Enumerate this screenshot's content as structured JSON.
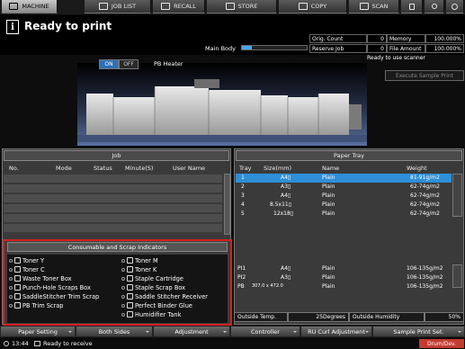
{
  "tabs": [
    {
      "label": "MACHINE",
      "active": true
    },
    {
      "label": "JOB LIST",
      "active": false
    },
    {
      "label": "RECALL",
      "active": false
    },
    {
      "label": "STORE",
      "active": false
    },
    {
      "label": "COPY",
      "active": false
    },
    {
      "label": "SCAN",
      "active": false
    }
  ],
  "header": {
    "title": "Ready to print",
    "main_body_label": "Main Body",
    "main_body_level": 0.15
  },
  "counters": {
    "orig_count_label": "Orig. Count",
    "orig_count": "0",
    "memory_label": "Memory",
    "memory": "100.000%",
    "reserve_job_label": "Reserve Job",
    "reserve_job": "0",
    "file_amount_label": "File Amount",
    "file_amount": "100.000%"
  },
  "scanner_status": "Ready to use scanner",
  "exec_sample_print": "Execute Sample Print",
  "pb_heater": {
    "on": "ON",
    "off": "OFF",
    "label": "PB Heater",
    "state": "on"
  },
  "job": {
    "title": "Job",
    "columns": [
      "No.",
      "Mode",
      "Status",
      "Minute(S)",
      "User Name"
    ]
  },
  "consumables": {
    "title": "Consumable and Scrap Indicators",
    "left": [
      "Toner Y",
      "Toner C",
      "Waste Toner Box",
      "Punch-Hole Scraps Box",
      "SaddleStitcher Trim Scrap",
      "PB Trim Scrap"
    ],
    "right": [
      "Toner M",
      "Toner K",
      "Staple Cartridge",
      "Staple Scrap Box",
      "Saddle Stitcher Receiver",
      "Perfect Binder Glue",
      "Humidifier Tank"
    ]
  },
  "tray": {
    "title": "Paper Tray",
    "columns": [
      "Tray",
      "Size(mm)",
      "Name",
      "Weight"
    ],
    "rows": [
      {
        "tray": "1",
        "size": "A4▯",
        "name": "Plain",
        "weight": "81-91g/m2",
        "selected": true
      },
      {
        "tray": "2",
        "size": "A3▯",
        "name": "Plain",
        "weight": "62-74g/m2",
        "selected": false
      },
      {
        "tray": "3",
        "size": "A4▯",
        "name": "Plain",
        "weight": "62-74g/m2",
        "selected": false
      },
      {
        "tray": "4",
        "size": "8.5x11▯",
        "name": "Plain",
        "weight": "62-74g/m2",
        "selected": false
      },
      {
        "tray": "5",
        "size": "12x18▯",
        "name": "Plain",
        "weight": "62-74g/m2",
        "selected": false
      }
    ],
    "lower_rows": [
      {
        "tray": "PI1",
        "size": "A4▯",
        "name": "Plain",
        "weight": "106-135g/m2"
      },
      {
        "tray": "PI2",
        "size": "A3▯",
        "name": "Plain",
        "weight": "106-135g/m2"
      },
      {
        "tray": "PB",
        "size": "307.0 x 472.0",
        "name": "Plain",
        "weight": "106-135g/m2"
      }
    ]
  },
  "outside": {
    "temp_label": "Outside Temp.",
    "temp": "25Degrees",
    "humidity_label": "Outside Humidity",
    "humidity": "50%"
  },
  "bottom_buttons": [
    "Paper Setting",
    "Both Sides",
    "Adjustment",
    "Controller",
    "RU Curl Adjustment",
    "Sample Print Set."
  ],
  "status": {
    "time": "13:44",
    "message": "Ready to receive",
    "badge": "Drum/Dev."
  }
}
